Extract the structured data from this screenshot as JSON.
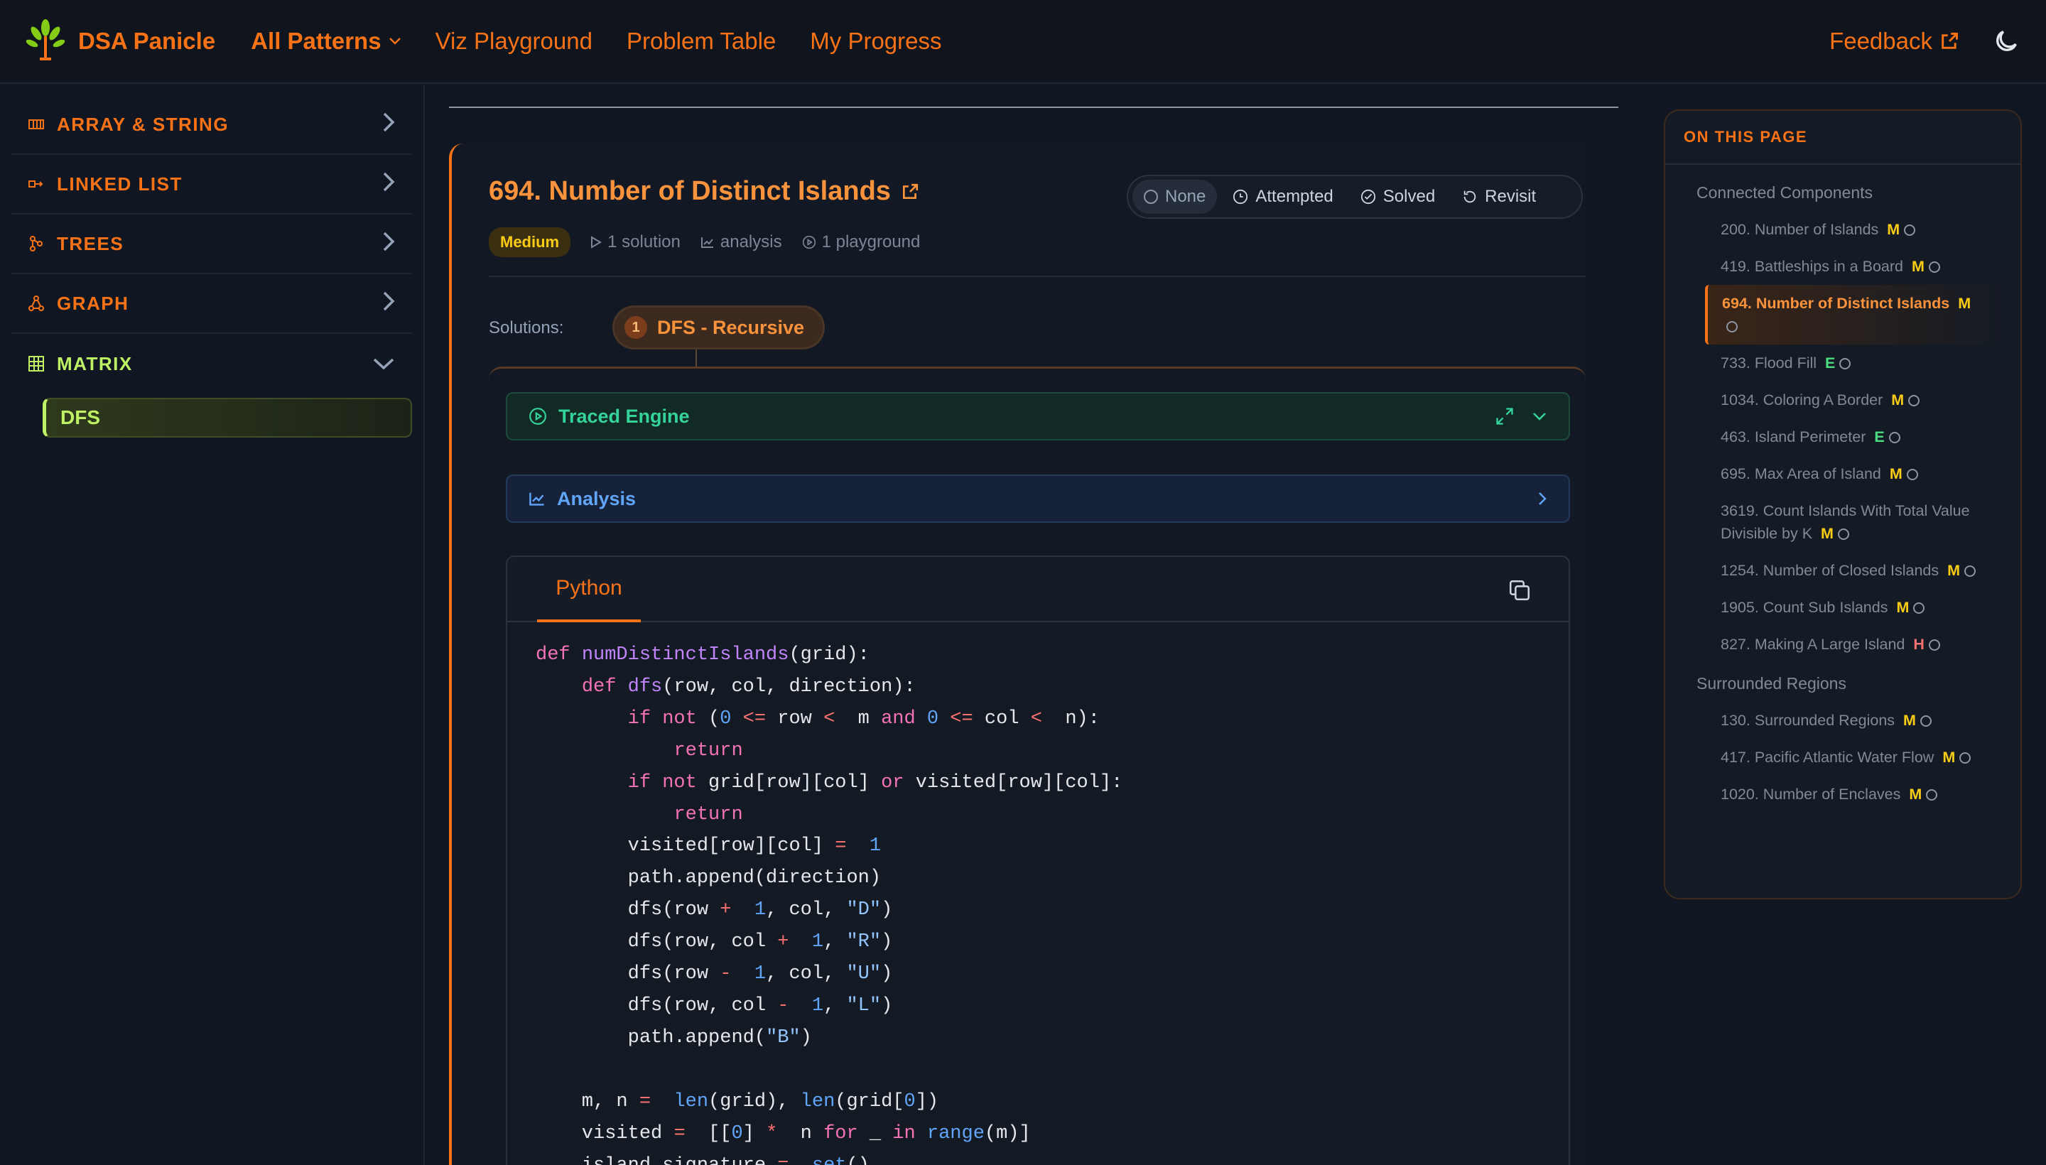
{
  "nav": {
    "brand": "DSA Panicle",
    "all_patterns": "All Patterns",
    "viz": "Viz Playground",
    "problem_table": "Problem Table",
    "progress": "My Progress",
    "feedback": "Feedback"
  },
  "sidebar": {
    "categories": [
      {
        "label": "ARRAY & STRING",
        "icon": "array-icon"
      },
      {
        "label": "LINKED LIST",
        "icon": "linked-list-icon"
      },
      {
        "label": "TREES",
        "icon": "tree-icon"
      },
      {
        "label": "GRAPH",
        "icon": "graph-icon"
      },
      {
        "label": "MATRIX",
        "icon": "grid-icon"
      }
    ],
    "active_sub": "DFS"
  },
  "problem": {
    "title": "694. Number of Distinct Islands",
    "difficulty": "Medium",
    "solutions_count": "1 solution",
    "analysis": "analysis",
    "playground": "1 playground",
    "status": [
      "None",
      "Attempted",
      "Solved",
      "Revisit"
    ],
    "solutions_label": "Solutions:",
    "solution_num": "1",
    "solution_name": "DFS - Recursive",
    "traced": "Traced Engine",
    "analysis_panel": "Analysis",
    "language": "Python"
  },
  "code": [
    [
      [
        "kw",
        "def "
      ],
      [
        "fn",
        "numDistinctIslands"
      ],
      [
        "",
        "(grid):"
      ]
    ],
    [
      [
        "",
        "    "
      ],
      [
        "kw",
        "def "
      ],
      [
        "fn",
        "dfs"
      ],
      [
        "",
        "(row, col, direction):"
      ]
    ],
    [
      [
        "",
        "        "
      ],
      [
        "kw",
        "if not "
      ],
      [
        "",
        "("
      ],
      [
        "nb",
        "0"
      ],
      [
        "op",
        " <= "
      ],
      [
        "",
        "row "
      ],
      [
        "op",
        "<"
      ],
      [
        "",
        "  m "
      ],
      [
        "kw",
        "and "
      ],
      [
        "nb",
        "0"
      ],
      [
        "op",
        " <= "
      ],
      [
        "",
        "col "
      ],
      [
        "op",
        "<"
      ],
      [
        "",
        "  n):"
      ]
    ],
    [
      [
        "",
        "            "
      ],
      [
        "kw",
        "return"
      ]
    ],
    [
      [
        "",
        "        "
      ],
      [
        "kw",
        "if not "
      ],
      [
        "",
        "grid[row][col] "
      ],
      [
        "kw",
        "or "
      ],
      [
        "",
        "visited[row][col]:"
      ]
    ],
    [
      [
        "",
        "            "
      ],
      [
        "kw",
        "return"
      ]
    ],
    [
      [
        "",
        "        visited[row][col] "
      ],
      [
        "op",
        "="
      ],
      [
        "",
        "  "
      ],
      [
        "nb",
        "1"
      ]
    ],
    [
      [
        "",
        "        path.append(direction)"
      ]
    ],
    [
      [
        "",
        "        dfs(row "
      ],
      [
        "op",
        "+"
      ],
      [
        "",
        "  "
      ],
      [
        "nb",
        "1"
      ],
      [
        "",
        ", col, "
      ],
      [
        "st",
        "\"D\""
      ],
      [
        "",
        ")"
      ]
    ],
    [
      [
        "",
        "        dfs(row, col "
      ],
      [
        "op",
        "+"
      ],
      [
        "",
        "  "
      ],
      [
        "nb",
        "1"
      ],
      [
        "",
        ", "
      ],
      [
        "st",
        "\"R\""
      ],
      [
        "",
        ")"
      ]
    ],
    [
      [
        "",
        "        dfs(row "
      ],
      [
        "op",
        "-"
      ],
      [
        "",
        "  "
      ],
      [
        "nb",
        "1"
      ],
      [
        "",
        ", col, "
      ],
      [
        "st",
        "\"U\""
      ],
      [
        "",
        ")"
      ]
    ],
    [
      [
        "",
        "        dfs(row, col "
      ],
      [
        "op",
        "-"
      ],
      [
        "",
        "  "
      ],
      [
        "nb",
        "1"
      ],
      [
        "",
        ", "
      ],
      [
        "st",
        "\"L\""
      ],
      [
        "",
        ")"
      ]
    ],
    [
      [
        "",
        "        path.append("
      ],
      [
        "st",
        "\"B\""
      ],
      [
        "",
        ")"
      ]
    ],
    [
      [
        "",
        ""
      ]
    ],
    [
      [
        "",
        "    m, n "
      ],
      [
        "op",
        "="
      ],
      [
        "",
        "  "
      ],
      [
        "nb",
        "len"
      ],
      [
        "",
        "(grid), "
      ],
      [
        "nb",
        "len"
      ],
      [
        "",
        "(grid["
      ],
      [
        "nb",
        "0"
      ],
      [
        "",
        "])"
      ]
    ],
    [
      [
        "",
        "    visited "
      ],
      [
        "op",
        "="
      ],
      [
        "",
        "  [["
      ],
      [
        "nb",
        "0"
      ],
      [
        "",
        "] "
      ],
      [
        "op",
        "*"
      ],
      [
        "",
        "  n "
      ],
      [
        "kw",
        "for "
      ],
      [
        "",
        "_ "
      ],
      [
        "kw",
        "in "
      ],
      [
        "nb",
        "range"
      ],
      [
        "",
        "(m)]"
      ]
    ],
    [
      [
        "",
        "    island_signature "
      ],
      [
        "op",
        "="
      ],
      [
        "",
        "  "
      ],
      [
        "nb",
        "set"
      ],
      [
        "",
        "()"
      ]
    ]
  ],
  "toc": {
    "heading": "ON THIS PAGE",
    "groups": [
      {
        "title": "Connected Components",
        "items": [
          {
            "label": "200. Number of Islands",
            "d": "M"
          },
          {
            "label": "419. Battleships in a Board",
            "d": "M"
          },
          {
            "label": "694. Number of Distinct Islands",
            "d": "M",
            "active": true
          },
          {
            "label": "733. Flood Fill",
            "d": "E"
          },
          {
            "label": "1034. Coloring A Border",
            "d": "M"
          },
          {
            "label": "463. Island Perimeter",
            "d": "E"
          },
          {
            "label": "695. Max Area of Island",
            "d": "M"
          },
          {
            "label": "3619. Count Islands With Total Value Divisible by K",
            "d": "M"
          },
          {
            "label": "1254. Number of Closed Islands",
            "d": "M"
          },
          {
            "label": "1905. Count Sub Islands",
            "d": "M"
          },
          {
            "label": "827. Making A Large Island",
            "d": "H"
          }
        ]
      },
      {
        "title": "Surrounded Regions",
        "items": [
          {
            "label": "130. Surrounded Regions",
            "d": "M"
          },
          {
            "label": "417. Pacific Atlantic Water Flow",
            "d": "M"
          },
          {
            "label": "1020. Number of Enclaves",
            "d": "M"
          }
        ]
      }
    ]
  },
  "colors": {
    "accent": "#f97316",
    "matrix": "#bef264",
    "traced": "#34d399",
    "analysis": "#60a5fa"
  }
}
